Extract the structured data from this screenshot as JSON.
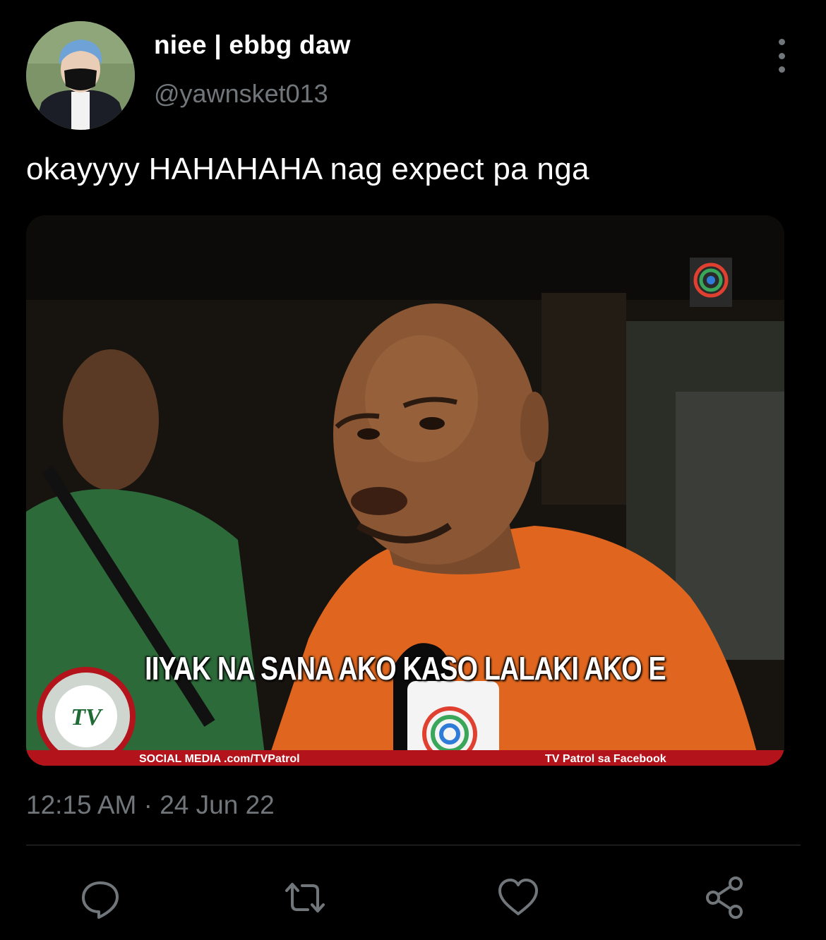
{
  "user": {
    "display_name": "niee | ebbg daw",
    "handle": "@yawnsket013"
  },
  "tweet": {
    "text": "okayyyy HAHAHAHA nag expect pa nga",
    "timestamp": "12:15 AM · 24 Jun 22"
  },
  "media": {
    "caption": "IIYAK NA SANA AKO KASO LALAKI AKO E",
    "ticker_left": "SOCIAL MEDIA .com/TVPatrol",
    "ticker_right": "TV Patrol sa Facebook"
  },
  "actions": {
    "reply_icon": "reply-icon",
    "retweet_icon": "retweet-icon",
    "like_icon": "heart-icon",
    "share_icon": "share-icon"
  },
  "colors": {
    "background": "#000000",
    "text_primary": "#ffffff",
    "text_secondary": "#71767b",
    "divider": "#2f3336",
    "ticker_red": "#b3131b",
    "shirt_orange": "#e0661f"
  }
}
